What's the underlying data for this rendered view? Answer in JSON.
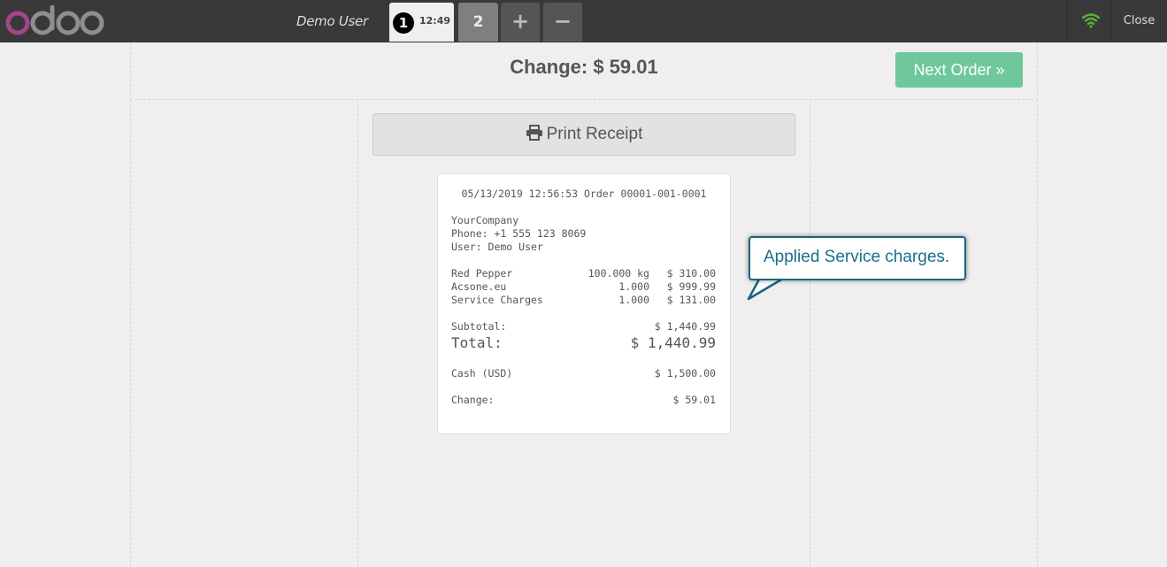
{
  "header": {
    "logo_text": "odoo",
    "username": "Demo User",
    "active_order": {
      "sequence": "1",
      "time": "12:49"
    },
    "other_order": {
      "sequence": "2"
    },
    "add_label": "+",
    "remove_label": "−",
    "close_label": "Close"
  },
  "screen": {
    "change_title": "Change: $ 59.01",
    "next_order_label": "Next Order »",
    "print_label": "Print Receipt"
  },
  "receipt": {
    "header_line": "05/13/2019 12:56:53 Order 00001-001-0001",
    "company": "YourCompany",
    "phone": "Phone: +1 555 123 8069",
    "user": "User: Demo User",
    "lines": [
      {
        "name": "Red Pepper",
        "qty": "100.000 kg",
        "price": "$ 310.00"
      },
      {
        "name": "Acsone.eu",
        "qty": "1.000",
        "price": "$ 999.99"
      },
      {
        "name": "Service Charges",
        "qty": "1.000",
        "price": "$ 131.00"
      }
    ],
    "subtotal_label": "Subtotal:",
    "subtotal_value": "$ 1,440.99",
    "total_label": "Total:",
    "total_value": "$ 1,440.99",
    "payment_label": "Cash (USD)",
    "payment_value": "$ 1,500.00",
    "change_label": "Change:",
    "change_value": "$ 59.01"
  },
  "callout": {
    "text": "Applied Service charges."
  },
  "colors": {
    "topbar": "#393939",
    "background": "#f0eeee",
    "next_order_green": "#6ec89b",
    "wifi_green": "#5ab134",
    "callout_border": "#19657f",
    "callout_text": "#1a6e88",
    "logo_purple": "#a24689",
    "logo_gray": "#8f8f8f"
  },
  "icons": {
    "wifi": "wifi-icon",
    "print": "printer-icon"
  }
}
